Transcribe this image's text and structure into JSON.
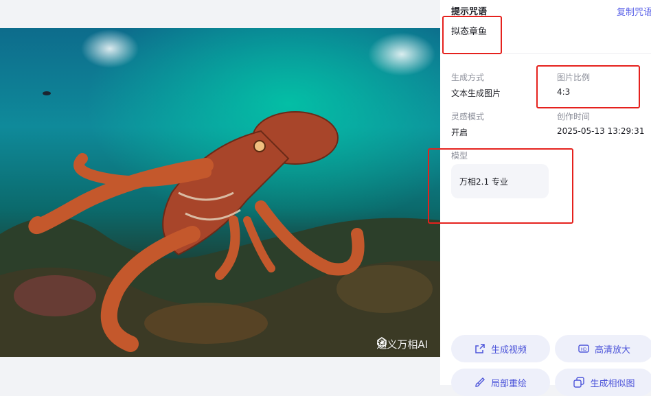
{
  "viewer": {
    "watermark": "通义万相AI",
    "image_subject": "octopus-photo"
  },
  "panel": {
    "prompt_heading": "提示咒语",
    "copy_label": "复制咒语",
    "prompt": "拟态章鱼",
    "meta": {
      "gen_mode_label": "生成方式",
      "gen_mode_value": "文本生成图片",
      "ratio_label": "图片比例",
      "ratio_value": "4:3",
      "inspiration_label": "灵感模式",
      "inspiration_value": "开启",
      "created_label": "创作时间",
      "created_value": "2025-05-13 13:29:31",
      "model_label": "模型",
      "model_value": "万相2.1 专业"
    },
    "actions": {
      "video": "生成视频",
      "upscale": "高清放大",
      "repaint": "局部重绘",
      "similar": "生成相似图"
    }
  },
  "colors": {
    "accent": "#5c63e8",
    "highlight": "#e5211d"
  }
}
